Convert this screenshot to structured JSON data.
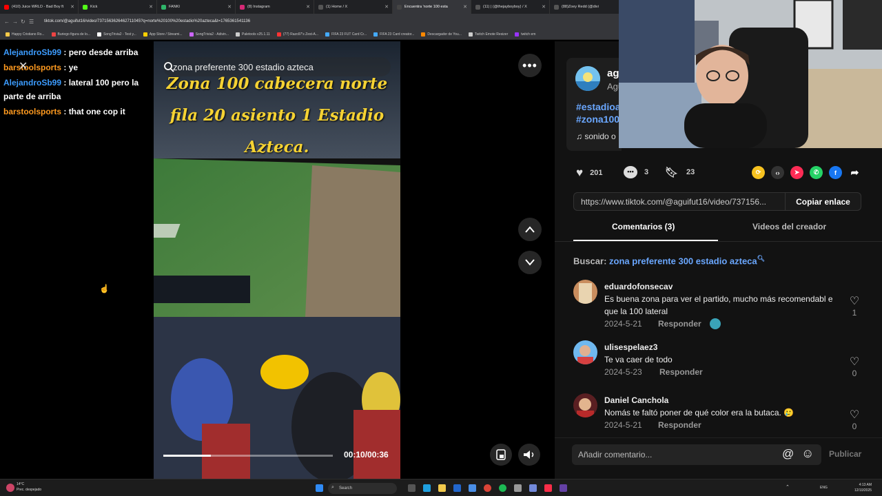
{
  "browser": {
    "tabs": [
      {
        "title": "(410) Juice WRLD - Bad Boy ft",
        "color": "#ff0000"
      },
      {
        "title": "Kick",
        "color": "#53fc18"
      },
      {
        "title": "FANKI",
        "color": "#2fb56a"
      },
      {
        "title": "(8) Instagram",
        "color": "#d62976"
      },
      {
        "title": "(1) Home / X",
        "color": "#111111"
      },
      {
        "title": "Encuentra 'norte 100 esta",
        "color": "#111111",
        "active": true
      },
      {
        "title": "(11) | (@thejayboyboy) / X",
        "color": "#111111"
      },
      {
        "title": "(88)Zoey Redd (@divi",
        "color": "#111111"
      }
    ],
    "url": "tiktok.com/@aguifut16/video/7371563626462711045?q=norte%20100%20estadio%20azteca&t=1765361541136",
    "bookmarks": [
      "Happy Cristiano Ro...",
      "Buriego figura de lo...",
      "SongTrivia2 - Test y...",
      "App Store / Streami...",
      "SongTrivia2 - Adivin...",
      "Paletools v25.1.11",
      "(77) Razo97's Zest-A...",
      "FIFA 23 FUT Card Cr...",
      "FIFA 23 Card creator...",
      "Descargador de You...",
      "Twitch Emote Resizer",
      "twitch em"
    ]
  },
  "chat": {
    "messages": [
      {
        "user": "AlejandroSb99",
        "color": "blue",
        "text": "pero desde arriba"
      },
      {
        "user": "barstoolsports",
        "color": "orange",
        "text": "ye"
      },
      {
        "user": "AlejandroSb99",
        "color": "blue",
        "text": "lateral 100 pero la parte de arriba"
      },
      {
        "user": "barstoolsports",
        "color": "orange",
        "text": "that one cop it"
      }
    ]
  },
  "video": {
    "search_text": "zona preferente 300 estadio azteca",
    "caption_lines": [
      "Zona 100 cabecera norte",
      "fila 20 asiento 1 Estadio",
      "Azteca."
    ],
    "time": "00:10/00:36",
    "progress": 0.28
  },
  "creator": {
    "name": "ag",
    "sub": "Agu",
    "tags": [
      "#estadioa",
      "#zona100"
    ],
    "sound": "sonido o"
  },
  "stats": {
    "likes": "201",
    "comments": "3",
    "saves": "23"
  },
  "share": {
    "link": "https://www.tiktok.com/@aguifut16/video/737156...",
    "copy_label": "Copiar enlace"
  },
  "tabs": {
    "comments": "Comentarios (3)",
    "creator_videos": "Videos del creador"
  },
  "related_search": {
    "label": "Buscar:",
    "query": "zona preferente 300 estadio azteca"
  },
  "comments": [
    {
      "user": "eduardofonsecav",
      "text": "Es buena zona para ver el partido, mucho más recomendabl e que la 100 lateral",
      "date": "2024-5-21",
      "reply": "Responder",
      "likes": "1"
    },
    {
      "user": "ulisespelaez3",
      "text": "Te va caer de todo",
      "date": "2024-5-23",
      "reply": "Responder",
      "likes": "0"
    },
    {
      "user": "Daniel Canchola",
      "text": "Nomás te faltó poner de qué color era la butaca. 🥲",
      "date": "2024-5-21",
      "reply": "Responder",
      "likes": "0"
    }
  ],
  "comment_box": {
    "placeholder": "Añadir comentario...",
    "publish": "Publicar"
  },
  "taskbar": {
    "weather_temp": "14°C",
    "weather_desc": "Prec. despejado",
    "search": "Search",
    "lang": "ENG",
    "time": "4:13 AM",
    "date": "12/10/2025"
  },
  "colors": {
    "accent_blue": "#6aa7ff",
    "caption_yellow": "#f5d233",
    "panel_bg": "#121212"
  }
}
